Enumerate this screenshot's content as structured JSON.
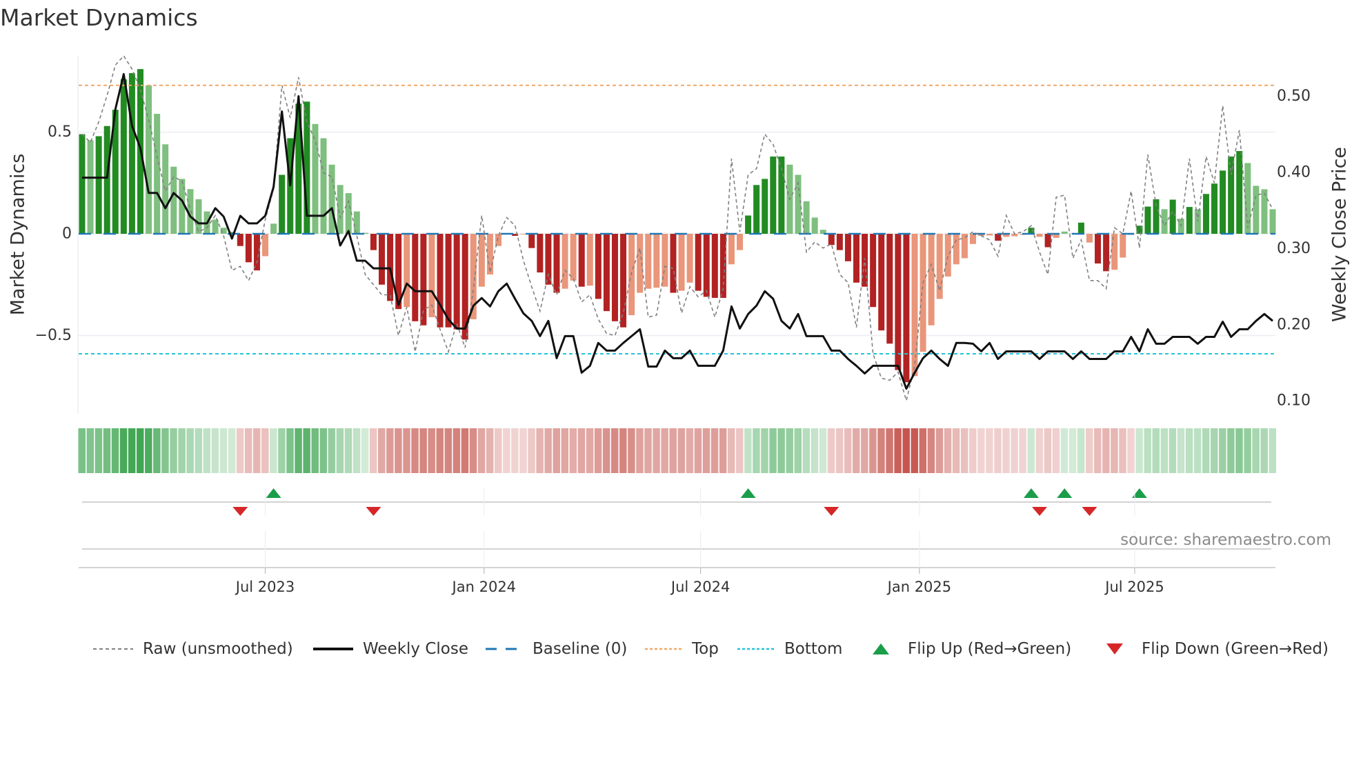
{
  "title": "Market Dynamics",
  "source": "source: sharemaestro.com",
  "colors": {
    "strong_up": "#228b22",
    "weak_up": "#7fbf7f",
    "strong_down": "#b22222",
    "weak_down": "#e9967a",
    "raw": "#808080",
    "close": "#111111",
    "baseline": "#1f77b4",
    "top": "#f0a868",
    "bottom": "#22c3d6",
    "flip_up": "#1a9e4a",
    "flip_down": "#d62728"
  },
  "legend": [
    {
      "key": "raw",
      "label": "Raw (unsmoothed)"
    },
    {
      "key": "close",
      "label": "Weekly Close"
    },
    {
      "key": "baseline",
      "label": "Baseline (0)"
    },
    {
      "key": "top",
      "label": "Top"
    },
    {
      "key": "bottom",
      "label": "Bottom"
    },
    {
      "key": "flip_up",
      "label": "Flip Up (Red→Green)"
    },
    {
      "key": "flip_down",
      "label": "Flip Down (Green→Red)"
    }
  ],
  "chart_data": {
    "type": "bar",
    "title": "Market Dynamics",
    "ylabel": "Market Dynamics",
    "y2label": "Weekly Close Price",
    "ylim": [
      -0.885,
      0.875
    ],
    "y2lim": [
      0.083,
      0.553
    ],
    "yticks": [
      {
        "v": 0.5,
        "label": "0.5"
      },
      {
        "v": 0,
        "label": "0"
      },
      {
        "v": -0.5,
        "label": "−0.5"
      }
    ],
    "y2ticks": [
      {
        "v": 0.5,
        "label": "0.50"
      },
      {
        "v": 0.4,
        "label": "0.40"
      },
      {
        "v": 0.3,
        "label": "0.30"
      },
      {
        "v": 0.2,
        "label": "0.20"
      },
      {
        "v": 0.1,
        "label": "0.10"
      }
    ],
    "x_start": "2023-01-28",
    "x_step_days": 7,
    "xticks": [
      {
        "date": "2023-07-01",
        "label": "Jul 2023"
      },
      {
        "date": "2024-01-01",
        "label": "Jan 2024"
      },
      {
        "date": "2024-07-01",
        "label": "Jul 2024"
      },
      {
        "date": "2025-01-01",
        "label": "Jan 2025"
      },
      {
        "date": "2025-07-01",
        "label": "Jul 2025"
      }
    ],
    "top_level": 0.73,
    "bottom_level": -0.59,
    "baseline": 0,
    "dynamics": [
      0.49,
      0.46,
      0.48,
      0.53,
      0.61,
      0.76,
      0.79,
      0.81,
      0.73,
      0.59,
      0.44,
      0.33,
      0.27,
      0.22,
      0.17,
      0.11,
      0.07,
      0.03,
      0.01,
      -0.06,
      -0.14,
      -0.18,
      -0.11,
      0.05,
      0.29,
      0.47,
      0.64,
      0.65,
      0.54,
      0.47,
      0.34,
      0.24,
      0.2,
      0.11,
      0.005,
      -0.08,
      -0.25,
      -0.33,
      -0.37,
      -0.36,
      -0.43,
      -0.45,
      -0.41,
      -0.46,
      -0.46,
      -0.47,
      -0.52,
      -0.42,
      -0.26,
      -0.2,
      -0.06,
      -0.003,
      -0.01,
      -0.003,
      -0.07,
      -0.19,
      -0.25,
      -0.29,
      -0.27,
      -0.23,
      -0.26,
      -0.255,
      -0.32,
      -0.38,
      -0.43,
      -0.46,
      -0.4,
      -0.29,
      -0.27,
      -0.265,
      -0.26,
      -0.29,
      -0.28,
      -0.24,
      -0.28,
      -0.31,
      -0.315,
      -0.315,
      -0.15,
      -0.08,
      0.09,
      0.24,
      0.27,
      0.38,
      0.38,
      0.34,
      0.29,
      0.16,
      0.08,
      0.02,
      -0.055,
      -0.08,
      -0.135,
      -0.24,
      -0.26,
      -0.36,
      -0.475,
      -0.54,
      -0.67,
      -0.73,
      -0.7,
      -0.58,
      -0.45,
      -0.32,
      -0.21,
      -0.15,
      -0.12,
      -0.05,
      -0.01,
      -0.008,
      -0.034,
      -0.015,
      -0.012,
      -0.005,
      0.03,
      -0.015,
      -0.066,
      -0.02,
      0.011,
      0.002,
      0.055,
      -0.043,
      -0.146,
      -0.184,
      -0.177,
      -0.117,
      -0.005,
      0.04,
      0.134,
      0.17,
      0.121,
      0.168,
      0.074,
      0.132,
      0.121,
      0.196,
      0.247,
      0.311,
      0.38,
      0.407,
      0.348,
      0.236,
      0.219,
      0.121
    ],
    "raw": [
      0.49,
      0.45,
      0.55,
      0.68,
      0.83,
      0.88,
      0.81,
      0.71,
      0.56,
      0.38,
      0.21,
      0.28,
      0.26,
      0.12,
      0.01,
      0.03,
      0.09,
      -0.01,
      -0.18,
      -0.16,
      -0.23,
      -0.14,
      0.07,
      0.22,
      0.73,
      0.57,
      0.77,
      0.55,
      0.46,
      0.3,
      0.28,
      0.08,
      0.16,
      -0.01,
      -0.2,
      -0.25,
      -0.3,
      -0.3,
      -0.5,
      -0.36,
      -0.58,
      -0.375,
      -0.35,
      -0.47,
      -0.58,
      -0.44,
      -0.56,
      -0.27,
      0.09,
      -0.19,
      -0.01,
      0.08,
      0.04,
      -0.13,
      -0.26,
      -0.38,
      -0.2,
      -0.3,
      -0.18,
      -0.22,
      -0.335,
      -0.3,
      -0.42,
      -0.49,
      -0.5,
      -0.39,
      -0.19,
      -0.07,
      -0.41,
      -0.4,
      -0.16,
      -0.17,
      -0.39,
      -0.26,
      -0.31,
      -0.28,
      -0.41,
      -0.27,
      0.37,
      0.01,
      0.29,
      0.32,
      0.49,
      0.44,
      0.32,
      0.17,
      0.25,
      -0.09,
      -0.04,
      -0.07,
      -0.05,
      -0.2,
      -0.24,
      -0.46,
      -0.12,
      -0.59,
      -0.71,
      -0.72,
      -0.68,
      -0.82,
      -0.65,
      -0.24,
      -0.15,
      -0.28,
      -0.11,
      -0.03,
      -0.02,
      0.01,
      -0.01,
      -0.03,
      -0.11,
      0.09,
      0.0,
      0.01,
      0.04,
      -0.09,
      -0.2,
      0.18,
      0.19,
      -0.12,
      -0.03,
      -0.23,
      -0.23,
      -0.27,
      0.03,
      0.0,
      0.21,
      -0.07,
      0.39,
      0.14,
      0.04,
      0.11,
      0.04,
      0.37,
      0.06,
      0.38,
      0.25,
      0.63,
      0.29,
      0.51,
      0.03,
      0.19,
      0.2,
      0.12
    ],
    "weekly_close": [
      0.393,
      0.393,
      0.393,
      0.393,
      0.483,
      0.529,
      0.461,
      0.432,
      0.373,
      0.373,
      0.353,
      0.373,
      0.363,
      0.342,
      0.333,
      0.333,
      0.353,
      0.342,
      0.313,
      0.343,
      0.333,
      0.333,
      0.343,
      0.381,
      0.48,
      0.383,
      0.5,
      0.343,
      0.343,
      0.343,
      0.353,
      0.304,
      0.323,
      0.284,
      0.284,
      0.274,
      0.274,
      0.274,
      0.226,
      0.254,
      0.244,
      0.244,
      0.244,
      0.226,
      0.207,
      0.195,
      0.195,
      0.225,
      0.235,
      0.224,
      0.244,
      0.254,
      0.234,
      0.215,
      0.205,
      0.185,
      0.205,
      0.156,
      0.185,
      0.185,
      0.137,
      0.146,
      0.176,
      0.166,
      0.166,
      0.176,
      0.185,
      0.194,
      0.145,
      0.145,
      0.166,
      0.156,
      0.156,
      0.166,
      0.146,
      0.146,
      0.146,
      0.166,
      0.224,
      0.195,
      0.214,
      0.225,
      0.244,
      0.234,
      0.205,
      0.195,
      0.214,
      0.185,
      0.185,
      0.185,
      0.166,
      0.166,
      0.155,
      0.146,
      0.136,
      0.146,
      0.146,
      0.146,
      0.146,
      0.116,
      0.137,
      0.156,
      0.166,
      0.155,
      0.146,
      0.176,
      0.176,
      0.175,
      0.165,
      0.176,
      0.155,
      0.165,
      0.165,
      0.165,
      0.165,
      0.155,
      0.165,
      0.165,
      0.165,
      0.155,
      0.165,
      0.155,
      0.155,
      0.155,
      0.165,
      0.165,
      0.184,
      0.165,
      0.194,
      0.175,
      0.175,
      0.184,
      0.184,
      0.184,
      0.175,
      0.184,
      0.184,
      0.204,
      0.184,
      0.194,
      0.194,
      0.205,
      0.214,
      0.205
    ],
    "flips_up": [
      23,
      80,
      114,
      118,
      127
    ],
    "flips_down": [
      19,
      35,
      90,
      115,
      121
    ]
  }
}
